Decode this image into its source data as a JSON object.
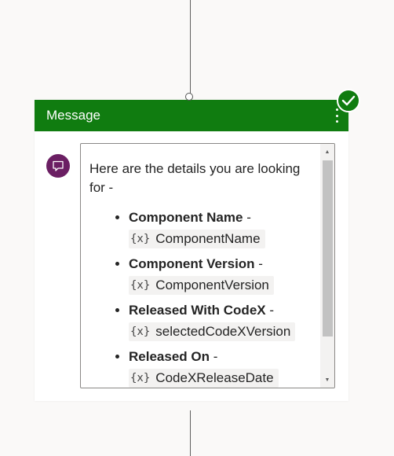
{
  "node": {
    "title": "Message",
    "status_icon": "check-circle-icon",
    "menu_icon": "more-vertical-icon",
    "accent_color": "#107c10",
    "avatar_color": "#6b1f63"
  },
  "message": {
    "intro": "Here are the details you are looking for -",
    "items": [
      {
        "label": "Component Name",
        "suffix": " -",
        "variable_icon": "{x}",
        "variable": "ComponentName"
      },
      {
        "label": "Component Version",
        "suffix": " -",
        "variable_icon": "{x}",
        "variable": "ComponentVersion"
      },
      {
        "label": "Released With CodeX",
        "suffix": " -",
        "variable_icon": "{x}",
        "variable": "selectedCodeXVersion"
      },
      {
        "label": "Released On",
        "suffix": " -",
        "variable_icon": "{x}",
        "variable": "CodeXReleaseDate"
      }
    ]
  }
}
